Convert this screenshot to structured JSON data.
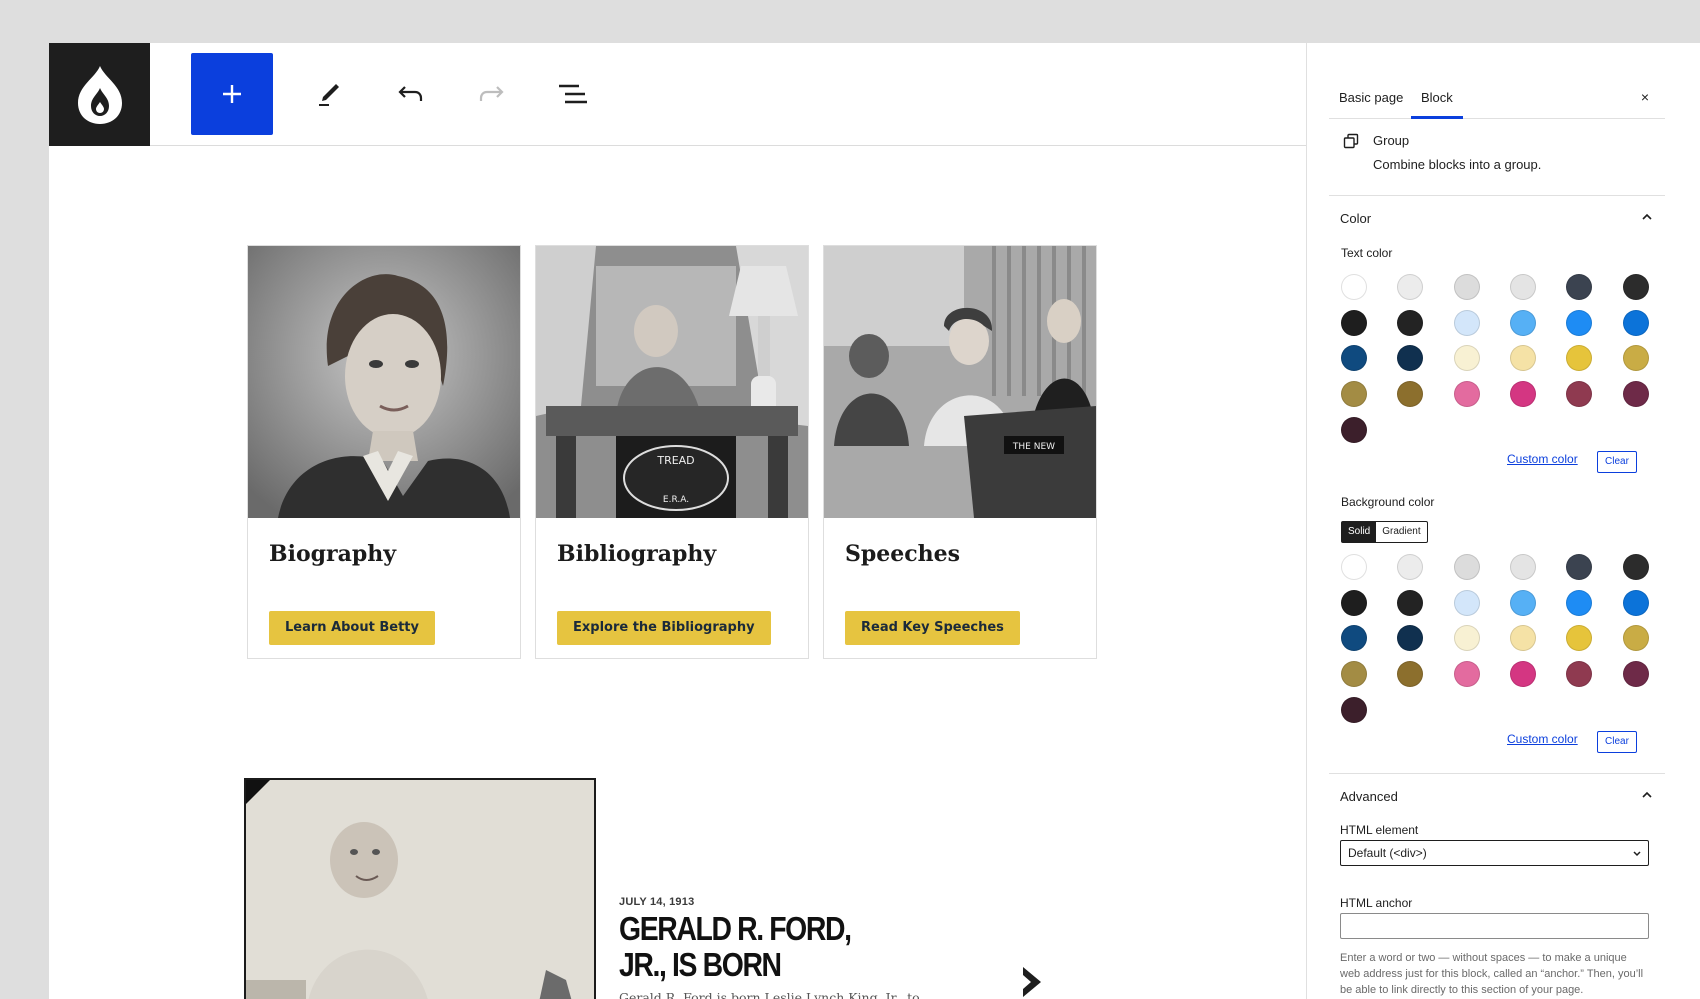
{
  "toolbar": {
    "logo": "drupal-logo",
    "buttons": [
      "add",
      "edit",
      "undo",
      "redo",
      "list-view"
    ]
  },
  "cards": [
    {
      "title": "Biography",
      "button": "Learn About Betty"
    },
    {
      "title": "Bibliography",
      "button": "Explore the Bibliography"
    },
    {
      "title": "Speeches",
      "button": "Read Key Speeches"
    }
  ],
  "timeline": {
    "date": "JULY 14, 1913",
    "title": "GERALD R. FORD, JR., IS BORN",
    "body": "Gerald R. Ford is born Leslie Lynch King, Jr., to Dorothy Ayer Gardner and Leslie Lynch King, Sr., in Omaha, Nebraska."
  },
  "sidebar": {
    "tabs": [
      "Basic page",
      "Block"
    ],
    "active_tab": "Block",
    "close": "×",
    "block": {
      "name": "Group",
      "description": "Combine blocks into a group."
    },
    "color_panel": {
      "title": "Color",
      "text_color_label": "Text color",
      "background_color_label": "Background color",
      "custom_color": "Custom color",
      "clear": "Clear",
      "segments": [
        "Solid",
        "Gradient"
      ],
      "active_segment": "Solid",
      "palette": [
        "#ffffff",
        "#ececec",
        "#dcdcdc",
        "#e4e4e4",
        "#3b4350",
        "#2c2c2c",
        "#1e1e1e",
        "#232323",
        "#d3e6fa",
        "#56b0f5",
        "#1e8cf4",
        "#0c73d9",
        "#0f4a7f",
        "#10304f",
        "#f8f1d3",
        "#f5e2a6",
        "#e6c43b",
        "#c9ac45",
        "#a38c44",
        "#8c6f2d",
        "#e36b9f",
        "#d43682",
        "#8f3a50",
        "#6e2a48",
        "#3c1f2b"
      ]
    },
    "advanced_panel": {
      "title": "Advanced",
      "html_element_label": "HTML element",
      "html_element_value": "Default (<div>)",
      "html_anchor_label": "HTML anchor",
      "html_anchor_value": "",
      "help": "Enter a word or two — without spaces — to make a unique web address just for this block, called an “anchor.” Then, you’ll be able to link directly to this section of your page."
    }
  }
}
